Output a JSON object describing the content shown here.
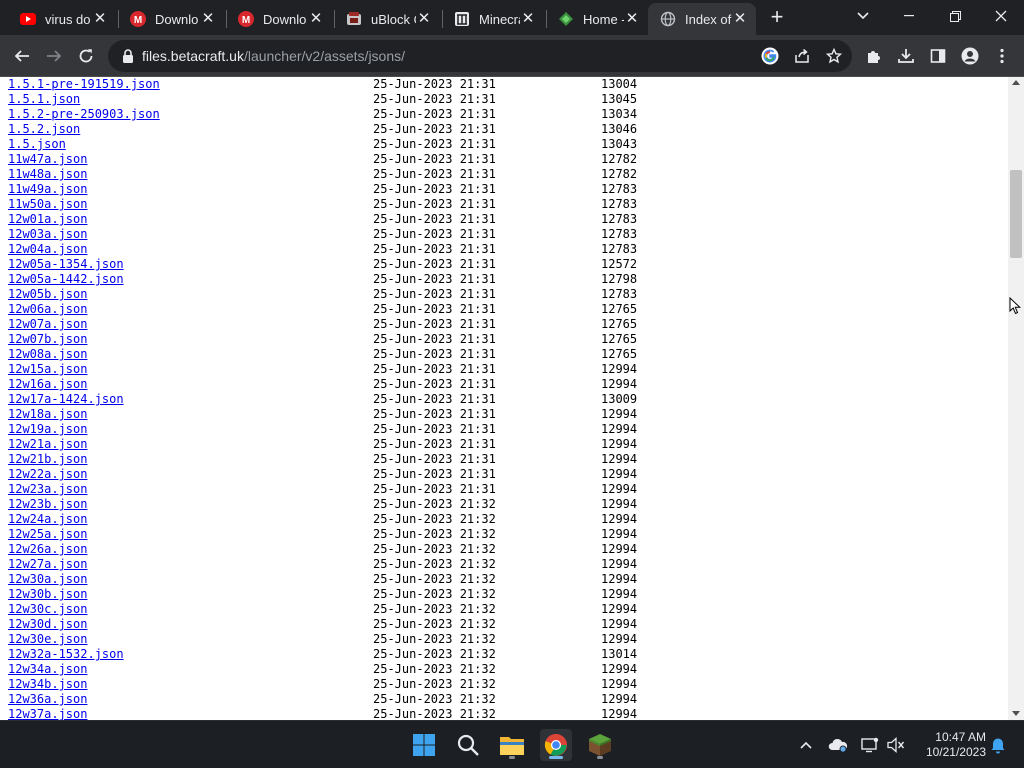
{
  "browser": {
    "tabs": [
      {
        "title": "virus do",
        "favicon": "youtube-icon"
      },
      {
        "title": "Downlo",
        "favicon": "mega-icon"
      },
      {
        "title": "Downlo",
        "favicon": "mega-icon"
      },
      {
        "title": "uBlock O",
        "favicon": "ublock-icon"
      },
      {
        "title": "Minecra",
        "favicon": "wiki-icon"
      },
      {
        "title": "Home -",
        "favicon": "betacraft-icon"
      },
      {
        "title": "Index of",
        "favicon": "globe-icon",
        "active": true
      }
    ],
    "close_glyph": "✕",
    "new_tab_glyph": "+",
    "url_host": "files.betacraft.uk",
    "url_path": "/launcher/v2/assets/jsons/"
  },
  "listing": [
    {
      "name": "1.5.1-pre-191519.json",
      "date": "25-Jun-2023 21:31",
      "size": "13004"
    },
    {
      "name": "1.5.1.json",
      "date": "25-Jun-2023 21:31",
      "size": "13045"
    },
    {
      "name": "1.5.2-pre-250903.json",
      "date": "25-Jun-2023 21:31",
      "size": "13034"
    },
    {
      "name": "1.5.2.json",
      "date": "25-Jun-2023 21:31",
      "size": "13046"
    },
    {
      "name": "1.5.json",
      "date": "25-Jun-2023 21:31",
      "size": "13043"
    },
    {
      "name": "11w47a.json",
      "date": "25-Jun-2023 21:31",
      "size": "12782"
    },
    {
      "name": "11w48a.json",
      "date": "25-Jun-2023 21:31",
      "size": "12782"
    },
    {
      "name": "11w49a.json",
      "date": "25-Jun-2023 21:31",
      "size": "12783"
    },
    {
      "name": "11w50a.json",
      "date": "25-Jun-2023 21:31",
      "size": "12783"
    },
    {
      "name": "12w01a.json",
      "date": "25-Jun-2023 21:31",
      "size": "12783"
    },
    {
      "name": "12w03a.json",
      "date": "25-Jun-2023 21:31",
      "size": "12783"
    },
    {
      "name": "12w04a.json",
      "date": "25-Jun-2023 21:31",
      "size": "12783"
    },
    {
      "name": "12w05a-1354.json",
      "date": "25-Jun-2023 21:31",
      "size": "12572"
    },
    {
      "name": "12w05a-1442.json",
      "date": "25-Jun-2023 21:31",
      "size": "12798"
    },
    {
      "name": "12w05b.json",
      "date": "25-Jun-2023 21:31",
      "size": "12783"
    },
    {
      "name": "12w06a.json",
      "date": "25-Jun-2023 21:31",
      "size": "12765"
    },
    {
      "name": "12w07a.json",
      "date": "25-Jun-2023 21:31",
      "size": "12765"
    },
    {
      "name": "12w07b.json",
      "date": "25-Jun-2023 21:31",
      "size": "12765"
    },
    {
      "name": "12w08a.json",
      "date": "25-Jun-2023 21:31",
      "size": "12765"
    },
    {
      "name": "12w15a.json",
      "date": "25-Jun-2023 21:31",
      "size": "12994"
    },
    {
      "name": "12w16a.json",
      "date": "25-Jun-2023 21:31",
      "size": "12994"
    },
    {
      "name": "12w17a-1424.json",
      "date": "25-Jun-2023 21:31",
      "size": "13009"
    },
    {
      "name": "12w18a.json",
      "date": "25-Jun-2023 21:31",
      "size": "12994"
    },
    {
      "name": "12w19a.json",
      "date": "25-Jun-2023 21:31",
      "size": "12994"
    },
    {
      "name": "12w21a.json",
      "date": "25-Jun-2023 21:31",
      "size": "12994"
    },
    {
      "name": "12w21b.json",
      "date": "25-Jun-2023 21:31",
      "size": "12994"
    },
    {
      "name": "12w22a.json",
      "date": "25-Jun-2023 21:31",
      "size": "12994"
    },
    {
      "name": "12w23a.json",
      "date": "25-Jun-2023 21:31",
      "size": "12994"
    },
    {
      "name": "12w23b.json",
      "date": "25-Jun-2023 21:32",
      "size": "12994"
    },
    {
      "name": "12w24a.json",
      "date": "25-Jun-2023 21:32",
      "size": "12994"
    },
    {
      "name": "12w25a.json",
      "date": "25-Jun-2023 21:32",
      "size": "12994"
    },
    {
      "name": "12w26a.json",
      "date": "25-Jun-2023 21:32",
      "size": "12994"
    },
    {
      "name": "12w27a.json",
      "date": "25-Jun-2023 21:32",
      "size": "12994"
    },
    {
      "name": "12w30a.json",
      "date": "25-Jun-2023 21:32",
      "size": "12994"
    },
    {
      "name": "12w30b.json",
      "date": "25-Jun-2023 21:32",
      "size": "12994"
    },
    {
      "name": "12w30c.json",
      "date": "25-Jun-2023 21:32",
      "size": "12994"
    },
    {
      "name": "12w30d.json",
      "date": "25-Jun-2023 21:32",
      "size": "12994"
    },
    {
      "name": "12w30e.json",
      "date": "25-Jun-2023 21:32",
      "size": "12994"
    },
    {
      "name": "12w32a-1532.json",
      "date": "25-Jun-2023 21:32",
      "size": "13014"
    },
    {
      "name": "12w34a.json",
      "date": "25-Jun-2023 21:32",
      "size": "12994"
    },
    {
      "name": "12w34b.json",
      "date": "25-Jun-2023 21:32",
      "size": "12994"
    },
    {
      "name": "12w36a.json",
      "date": "25-Jun-2023 21:32",
      "size": "12994"
    },
    {
      "name": "12w37a.json",
      "date": "25-Jun-2023 21:32",
      "size": "12994"
    }
  ],
  "taskbar": {
    "time": "10:47 AM",
    "date": "10/21/2023",
    "apps": [
      "start-button",
      "search-button",
      "file-explorer",
      "chrome",
      "minecraft-launcher"
    ]
  },
  "colors": {
    "link": "#0000ee",
    "chrome_dark": "#202124",
    "chrome_toolbar": "#35363a",
    "page_bg": "#ffffff"
  }
}
